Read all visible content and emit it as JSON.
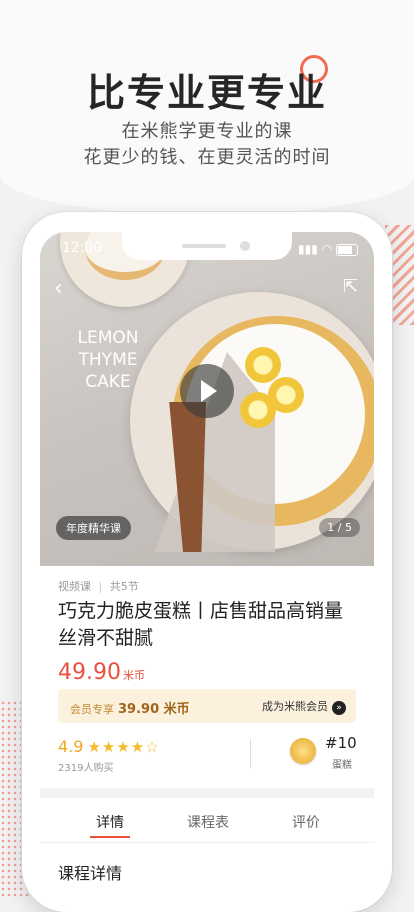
{
  "promo": {
    "headline": "比专业更专业",
    "sub1": "在米熊学更专业的课",
    "sub2": "花更少的钱、在更灵活的时间"
  },
  "status": {
    "time": "12:00"
  },
  "media": {
    "photo_text": "LEMON THYME CAKE",
    "badge": "年度精华课",
    "pager": "1 / 5"
  },
  "course": {
    "type": "视频课",
    "lessons": "共5节",
    "title": "巧克力脆皮蛋糕丨店售甜品高销量 丝滑不甜腻",
    "price": "49.90",
    "price_unit": "米币",
    "member_label": "会员专享",
    "member_price": "39.90 米币",
    "member_cta": "成为米熊会员",
    "rating": "4.9",
    "stars": "★★★★☆",
    "buyers": "2319人购买",
    "rank": "#10",
    "rank_category": "蛋糕"
  },
  "tabs": [
    "详情",
    "课程表",
    "评价"
  ],
  "detail_title": "课程详情",
  "colors": {
    "accent": "#e8503f",
    "member_bg": "#fbf1dd",
    "gold": "#f5b92b"
  }
}
